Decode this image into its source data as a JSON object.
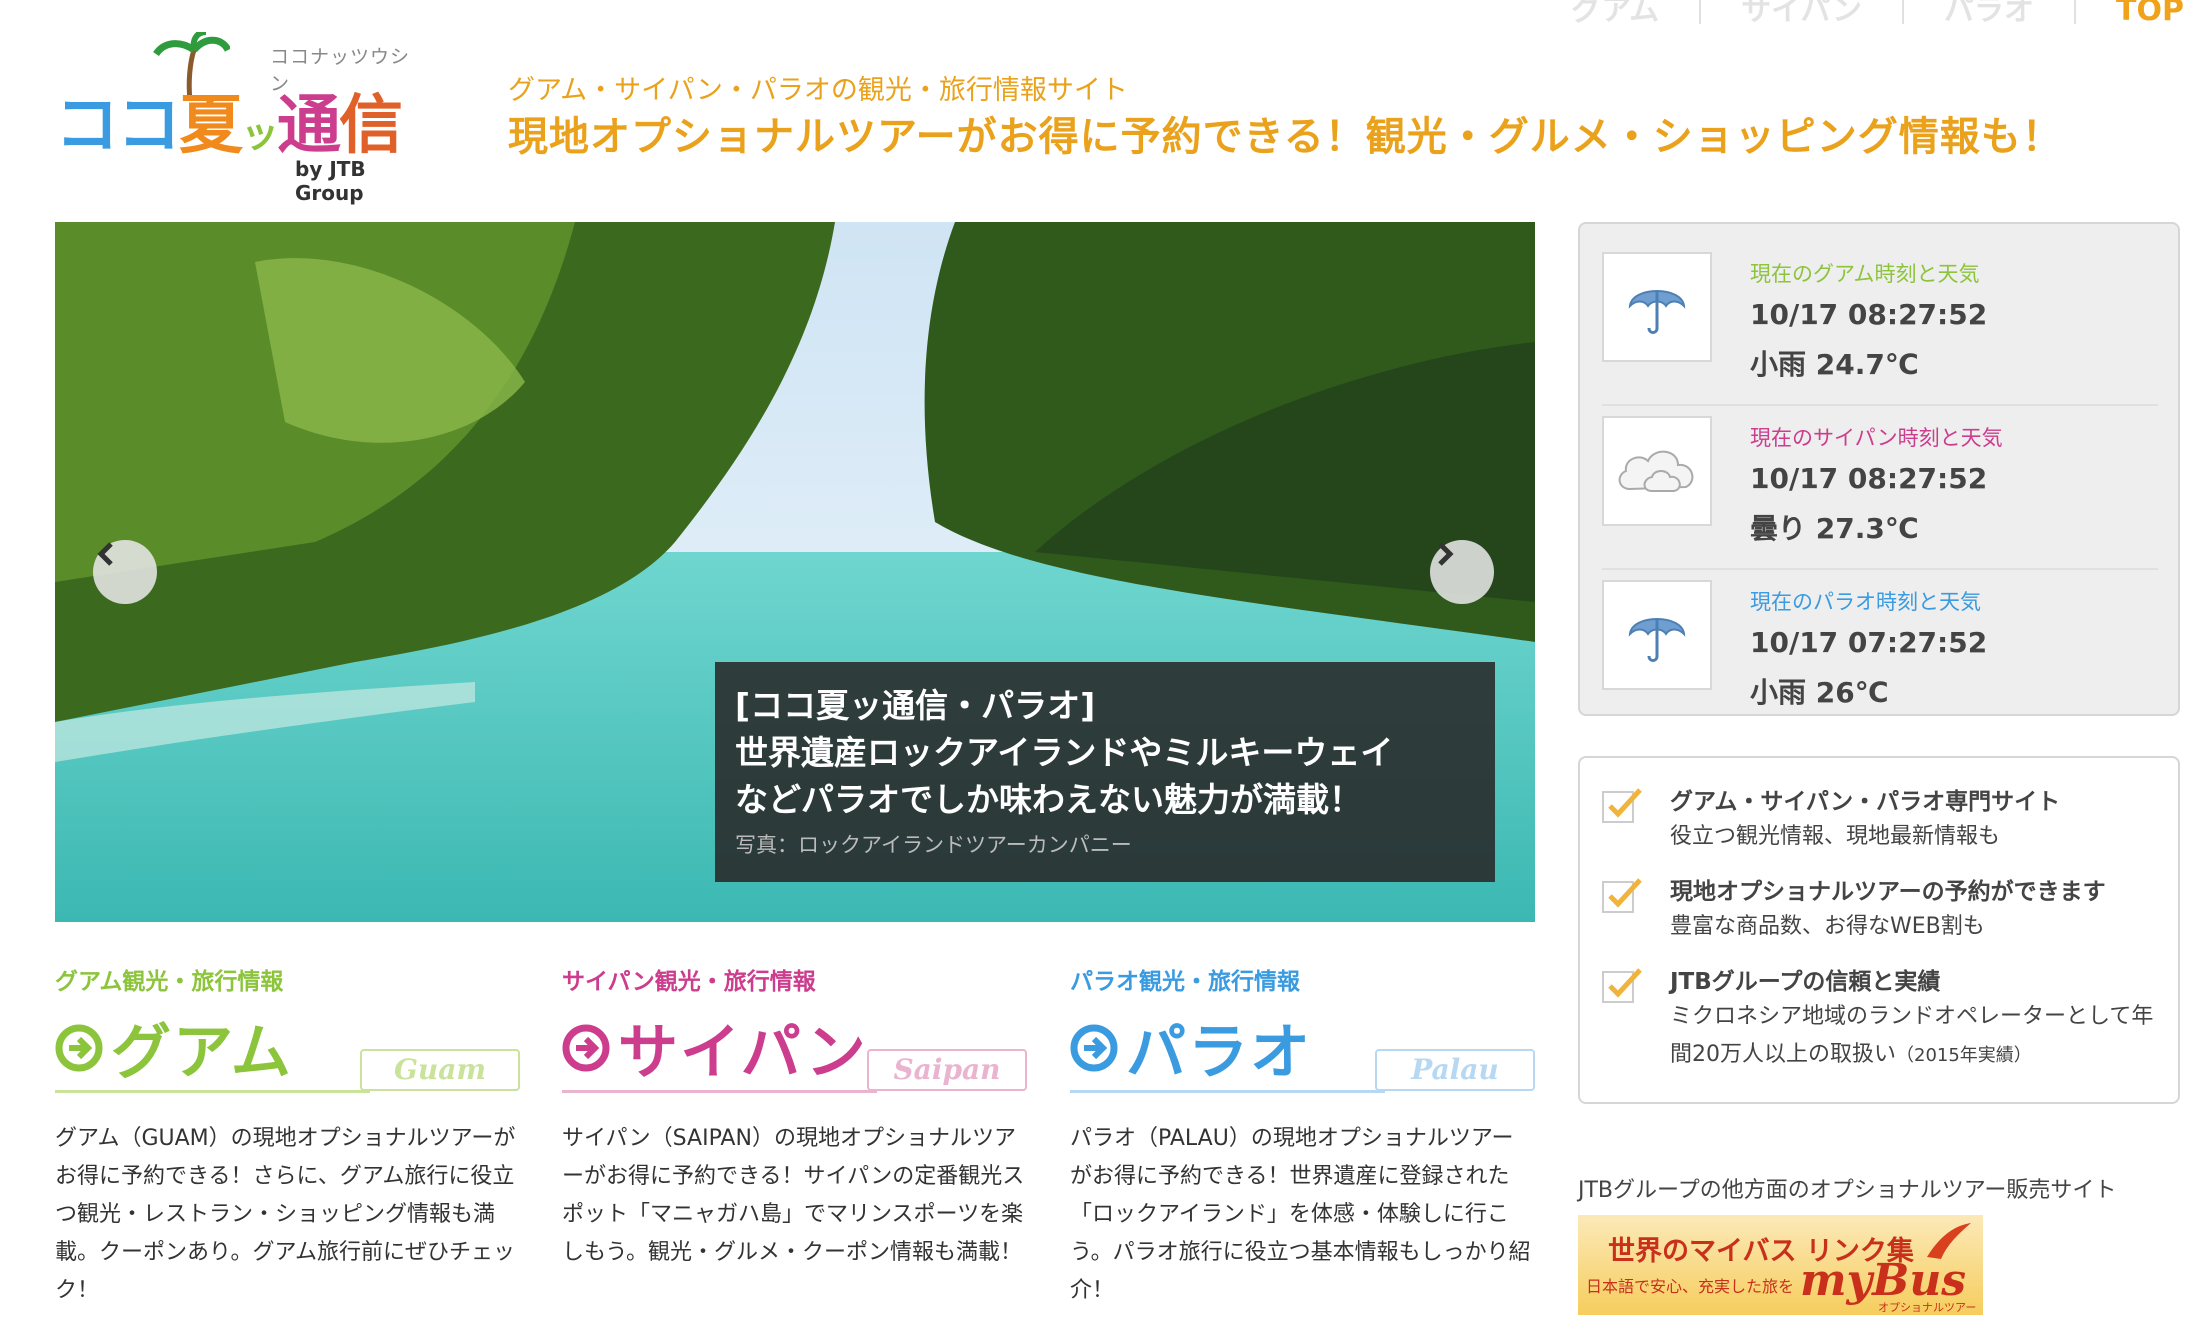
{
  "topnav": {
    "items": [
      "グアム",
      "サイパン",
      "パラオ"
    ],
    "top": "TOP"
  },
  "logo": {
    "kana": "ココナッツウシン",
    "chars": [
      "コ",
      "コ",
      "夏",
      "ッ",
      "通",
      "信"
    ],
    "by": "by JTB Group"
  },
  "tagline": {
    "line1": "グアム・サイパン・パラオの観光・旅行情報サイト",
    "line2": "現地オプショナルツアーがお得に予約できる！観光・グルメ・ショッピング情報も！"
  },
  "hero": {
    "prev_icon": "chevron-left-icon",
    "next_icon": "chevron-right-icon",
    "caption": {
      "line1": "[ココ夏ッ通信・パラオ]",
      "line2": "世界遺産ロックアイランドやミルキーウェイ",
      "line3": "などパラオでしか味わえない魅力が満載！",
      "credit": "写真：ロックアイランドツアーカンパニー"
    }
  },
  "destinations": [
    {
      "sub": "グアム観光・旅行情報",
      "title": "グアム",
      "tag": "Guam",
      "color": "#8cc43c",
      "tag_color": "#c9e39a",
      "desc": "グアム（GUAM）の現地オプショナルツアーがお得に予約できる！さらに、グアム旅行に役立つ観光・レストラン・ショッピング情報も満載。クーポンあり。グアム旅行前にぜひチェック！"
    },
    {
      "sub": "サイパン観光・旅行情報",
      "title": "サイパン",
      "tag": "Saipan",
      "color": "#cc3d8e",
      "tag_color": "#eab4d0",
      "desc": "サイパン（SAIPAN）の現地オプショナルツアーがお得に予約できる！サイパンの定番観光スポット「マニャガハ島」でマリンスポーツを楽しもう。観光・グルメ・クーポン情報も満載！"
    },
    {
      "sub": "パラオ観光・旅行情報",
      "title": "パラオ",
      "tag": "Palau",
      "color": "#3a9be0",
      "tag_color": "#b7d8f2",
      "desc": "パラオ（PALAU）の現地オプショナルツアーがお得に予約できる！世界遺産に登録された「ロックアイランド」を体感・体験しに行こう。パラオ旅行に役立つ基本情報もしっかり紹介！"
    }
  ],
  "weather": [
    {
      "label": "現在のグアム時刻と天気",
      "time": "10/17 08:27:52",
      "cond": "小雨 24.7℃",
      "icon": "umbrella-icon",
      "color": "#8cc43c"
    },
    {
      "label": "現在のサイパン時刻と天気",
      "time": "10/17 08:27:52",
      "cond": "曇り 27.3℃",
      "icon": "cloud-icon",
      "color": "#cc3d8e"
    },
    {
      "label": "現在のパラオ時刻と天気",
      "time": "10/17 07:27:52",
      "cond": "小雨 26℃",
      "icon": "umbrella-icon",
      "color": "#3a9be0"
    }
  ],
  "features": [
    {
      "title": "グアム・サイパン・パラオ専門サイト",
      "desc": "役立つ観光情報、現地最新情報も"
    },
    {
      "title": "現地オプショナルツアーの予約ができます",
      "desc": "豊富な商品数、お得なWEB割も"
    },
    {
      "title": "JTBグループの信頼と実績",
      "desc": "ミクロネシア地域のランドオペレーターとして年間20万人以上の取扱い",
      "note": "（2015年実績）"
    }
  ],
  "jtb_note": "JTBグループの他方面のオプショナルツアー販売サイト",
  "mybus": {
    "line1": "世界のマイバス リンク集",
    "line2": "日本語で安心、充実した旅を",
    "brand": "myBus",
    "small": "オプショナルツアー"
  }
}
